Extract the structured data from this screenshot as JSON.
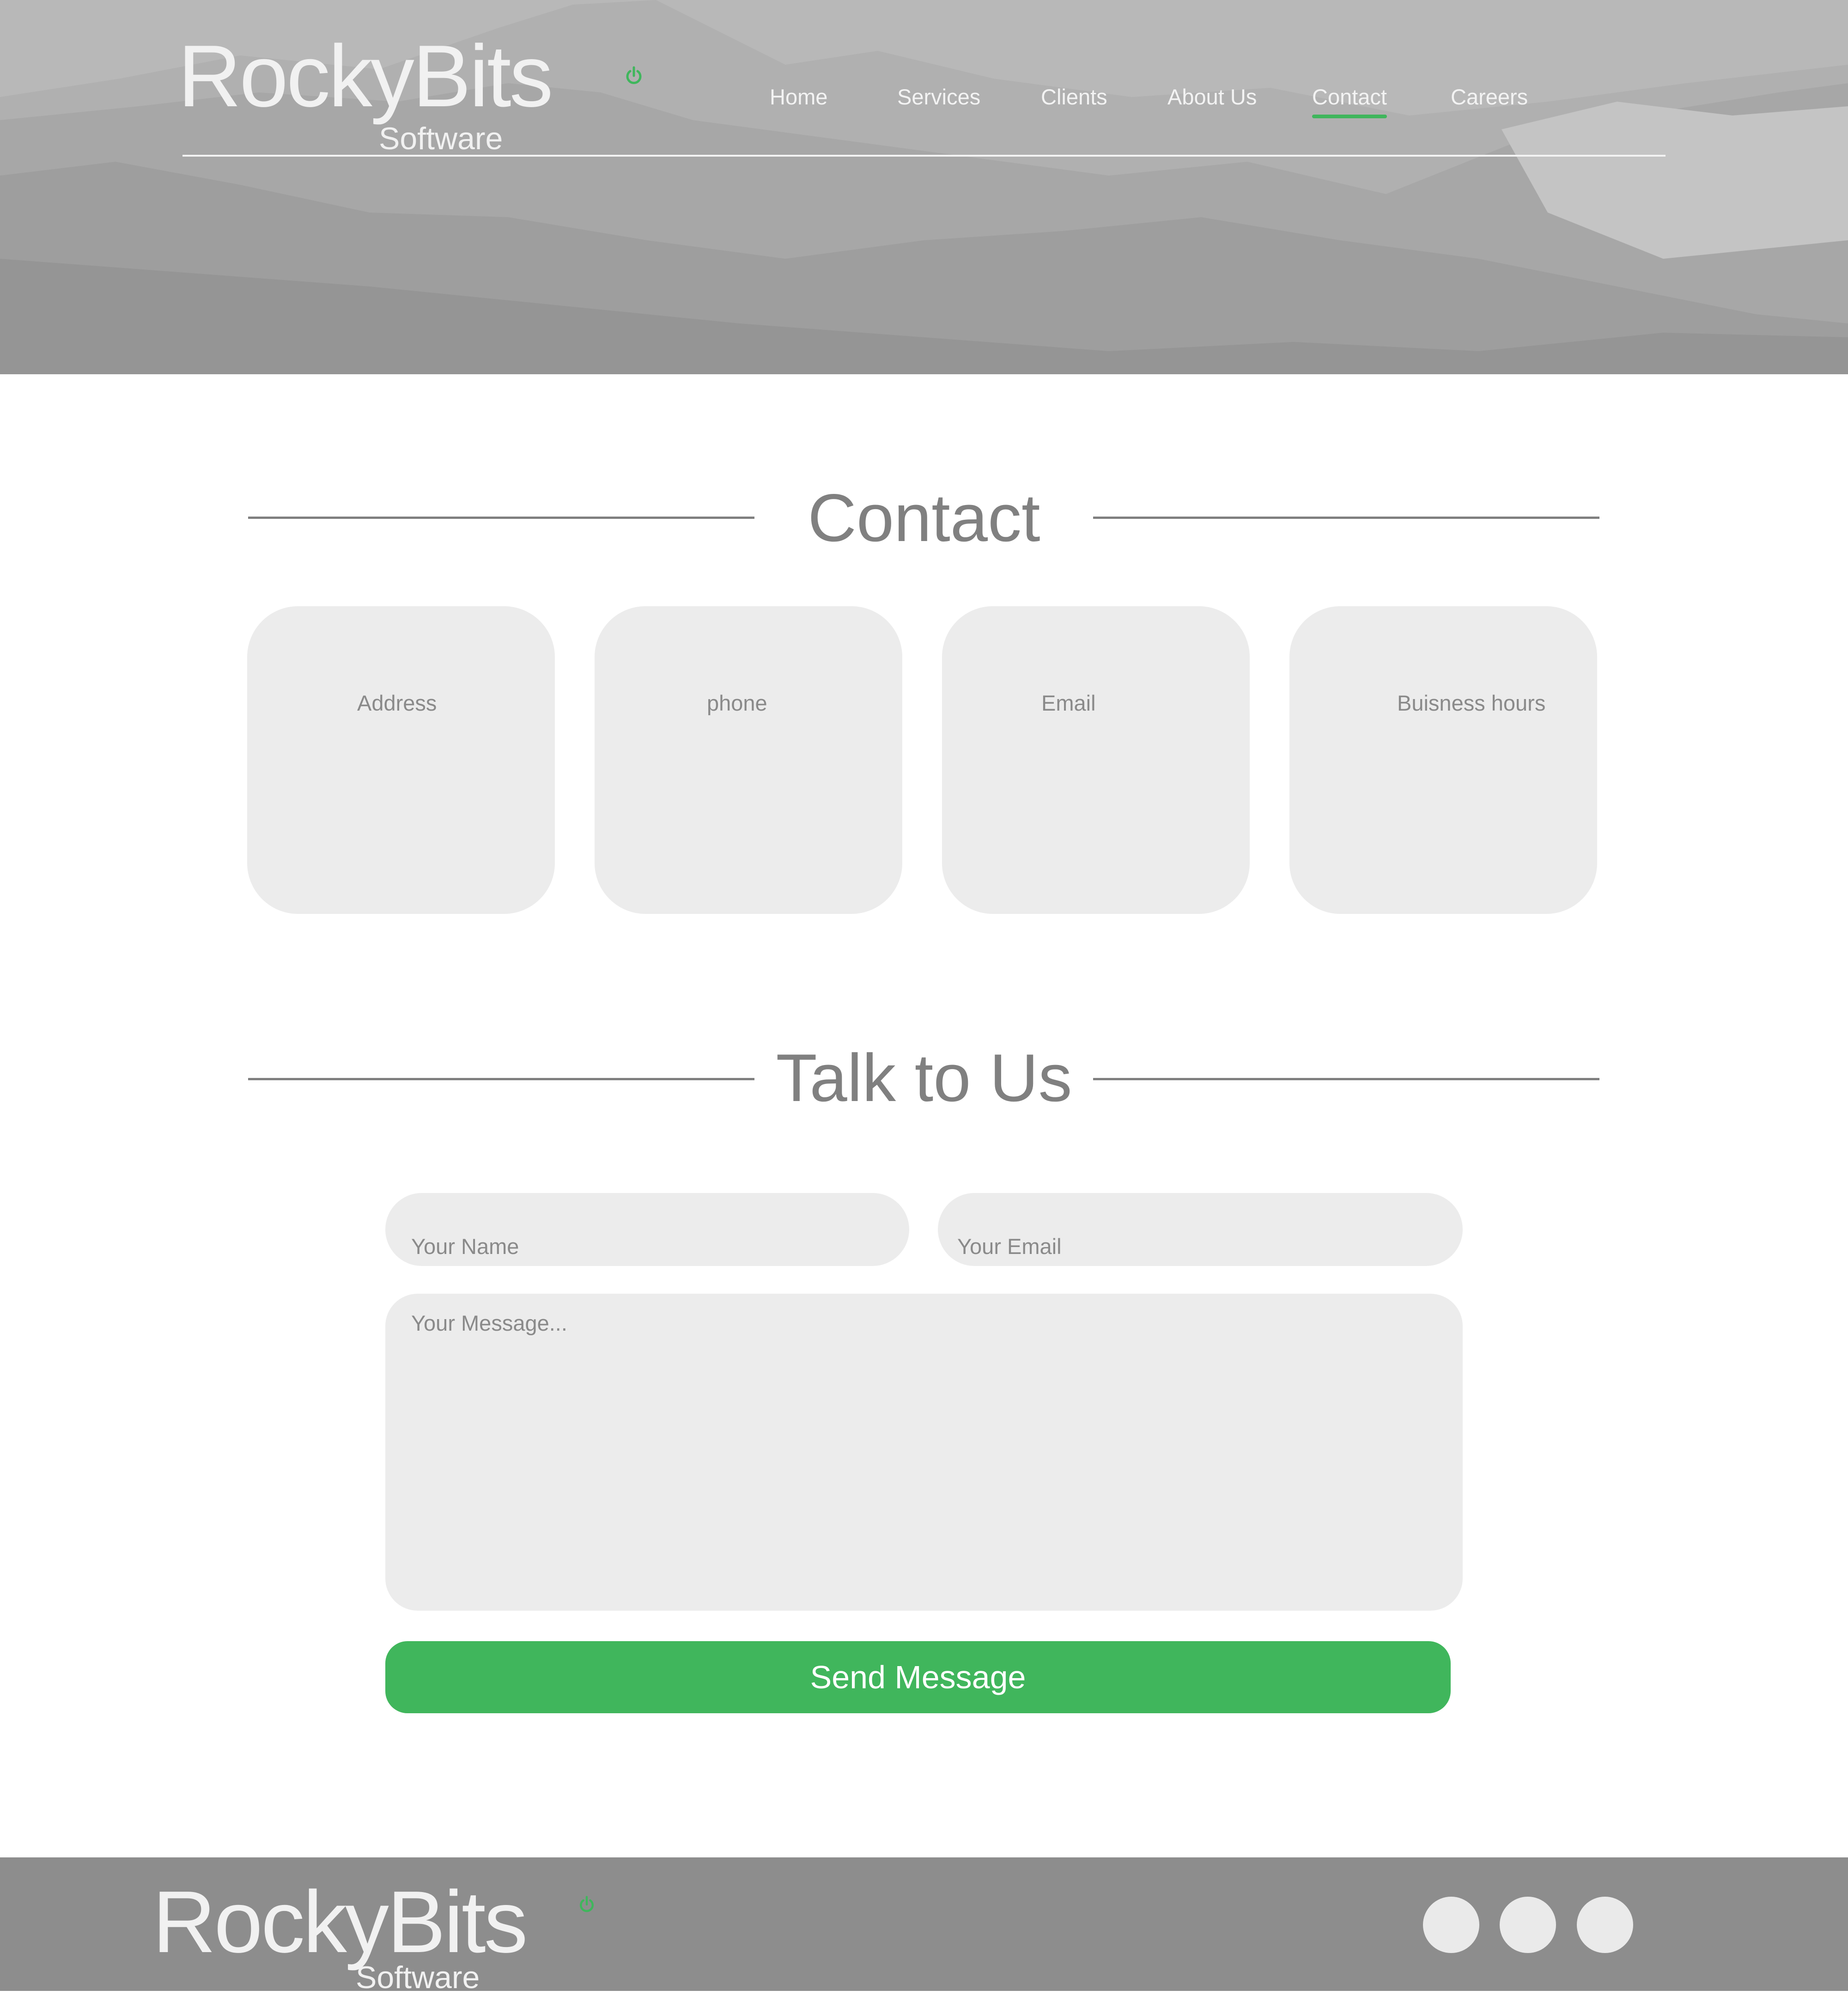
{
  "brand": {
    "name": "RockyBits",
    "tagline": "Software",
    "logo_icon": "power-icon",
    "accent_color": "#3fb65c"
  },
  "nav": {
    "items": [
      "Home",
      "Services",
      "Clients",
      "About Us",
      "Contact",
      "Careers"
    ],
    "active": "Contact"
  },
  "contact_section": {
    "title": "Contact",
    "cards": [
      "Address",
      "phone",
      "Email",
      "Buisness hours"
    ]
  },
  "talk_section": {
    "title": "Talk to Us",
    "name_placeholder": "Your Name",
    "email_placeholder": "Your Email",
    "message_placeholder": "Your Message...",
    "send_label": "Send Message"
  },
  "footer": {
    "brand_name": "RockyBits",
    "brand_tagline": "Software",
    "social_icons": [
      "social-icon-1",
      "social-icon-2",
      "social-icon-3"
    ]
  }
}
